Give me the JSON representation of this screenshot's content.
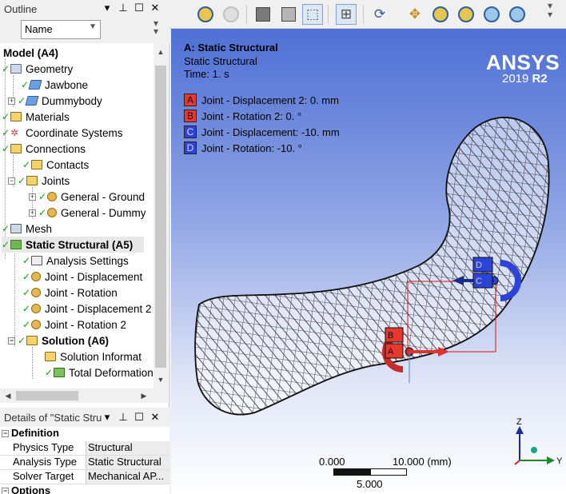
{
  "outline": {
    "title": "Outline",
    "filter_value": "Name",
    "tree": [
      {
        "label": "Model (A4)",
        "bold": true
      },
      {
        "label": "Geometry"
      },
      {
        "label": "Jawbone"
      },
      {
        "label": "Dummybody"
      },
      {
        "label": "Materials"
      },
      {
        "label": "Coordinate Systems"
      },
      {
        "label": "Connections"
      },
      {
        "label": "Contacts"
      },
      {
        "label": "Joints"
      },
      {
        "label": "General - Ground"
      },
      {
        "label": "General - Dummy"
      },
      {
        "label": "Mesh"
      },
      {
        "label": "Static Structural (A5)",
        "bold": true,
        "selected": true
      },
      {
        "label": "Analysis Settings"
      },
      {
        "label": "Joint - Displacement"
      },
      {
        "label": "Joint - Rotation"
      },
      {
        "label": "Joint - Displacement 2"
      },
      {
        "label": "Joint - Rotation 2"
      },
      {
        "label": "Solution (A6)",
        "bold": true
      },
      {
        "label": "Solution Informat"
      },
      {
        "label": "Total Deformation"
      }
    ]
  },
  "details": {
    "title": "Details of \"Static Stru",
    "sections": [
      {
        "label": "Definition",
        "rows": [
          {
            "key": "Physics Type",
            "value": "Structural"
          },
          {
            "key": "Analysis Type",
            "value": "Static Structural"
          },
          {
            "key": "Solver Target",
            "value": "Mechanical AP..."
          }
        ]
      },
      {
        "label": "Options"
      }
    ]
  },
  "viewport": {
    "title": "A: Static Structural",
    "subtitle": "Static Structural",
    "time": "Time: 1. s",
    "logo": "ANSYS",
    "version": "2019",
    "release": "R2",
    "legend": [
      {
        "letter": "A",
        "text": "Joint - Displacement 2: 0. mm",
        "color": "#e8372f"
      },
      {
        "letter": "B",
        "text": "Joint - Rotation 2: 0. °",
        "color": "#e8372f"
      },
      {
        "letter": "C",
        "text": "Joint - Displacement: -10. mm",
        "color": "#2d43d8"
      },
      {
        "letter": "D",
        "text": "Joint - Rotation: -10. °",
        "color": "#2d43d8"
      }
    ],
    "scale": {
      "left": "0.000",
      "right": "10.000 (mm)",
      "mid": "5.000"
    },
    "triad": {
      "z": "Z",
      "y": "Y"
    }
  },
  "toolbar": {
    "icons": [
      "zoom-back-icon",
      "zoom-forward-icon",
      "shaded-cube-icon",
      "light-cube-icon",
      "select-mode-icon",
      "box-select-icon",
      "rotate-icon",
      "pan-icon",
      "zoom-icon",
      "zoom-box-icon",
      "zoom-fit-icon",
      "zoom-visible-icon"
    ]
  },
  "colors": {
    "viewport_top": "#4e6fd4",
    "red_joint": "#e8372f",
    "blue_joint": "#2d43d8"
  }
}
